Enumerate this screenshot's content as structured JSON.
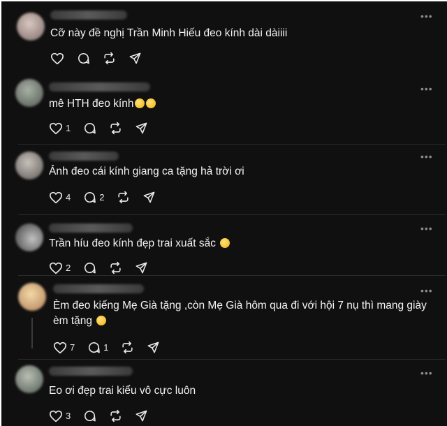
{
  "comments": [
    {
      "text": "Cỡ này đề nghị Trần Minh Hiếu đeo kính dài dàiiii",
      "likes": "",
      "replies": ""
    },
    {
      "text": "mê HTH đeo kính",
      "likes": "1",
      "replies": ""
    },
    {
      "text": "Ảnh đeo cái kính giang ca tặng hả trời ơi",
      "likes": "4",
      "replies": "2"
    },
    {
      "text": "Trần híu đeo kính đẹp trai xuất sắc",
      "likes": "2",
      "replies": ""
    },
    {
      "text": "Èm đeo kiếng Mẹ Già tặng ,còn Mẹ Già hôm qua đi với hội 7 nụ thì mang giày",
      "text2": "èm tặng",
      "likes": "7",
      "replies": "1"
    },
    {
      "text": "Eo ơi đẹp trai kiểu vô cực luôn",
      "likes": "3",
      "replies": ""
    }
  ],
  "icons": [
    "heart-icon",
    "comment-icon",
    "repost-icon",
    "share-icon",
    "more-icon"
  ],
  "colors": {
    "background": "#101010",
    "text": "#f3f3f3",
    "muted": "#8a8a8a"
  }
}
